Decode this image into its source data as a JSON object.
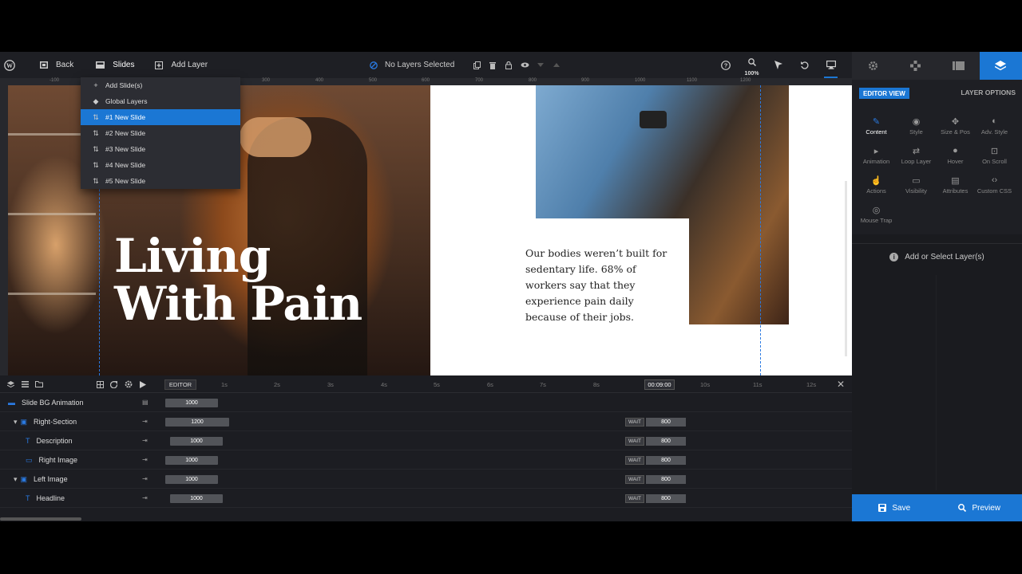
{
  "toolbar": {
    "back_label": "Back",
    "slides_label": "Slides",
    "add_layer_label": "Add Layer",
    "selection_status": "No Layers Selected",
    "zoom_level": "100%"
  },
  "ruler": {
    "ticks": [
      "-100",
      "100",
      "200",
      "300",
      "400",
      "500",
      "600",
      "700",
      "800",
      "900",
      "1000",
      "1100",
      "1200"
    ]
  },
  "slides_menu": {
    "items": [
      {
        "label": "Add Slide(s)",
        "icon": "plus-icon",
        "active": false
      },
      {
        "label": "Global Layers",
        "icon": "layers-icon",
        "active": false
      },
      {
        "label": "#1 New Slide",
        "icon": "slide-icon",
        "active": true
      },
      {
        "label": "#2 New Slide",
        "icon": "slide-icon",
        "active": false
      },
      {
        "label": "#3 New Slide",
        "icon": "slide-icon",
        "active": false
      },
      {
        "label": "#4 New Slide",
        "icon": "slide-icon",
        "active": false
      },
      {
        "label": "#5 New Slide",
        "icon": "slide-icon",
        "active": false
      }
    ]
  },
  "slide": {
    "headline_line1": "Living",
    "headline_line2": "With Pain",
    "description": "Our bodies weren’t built for sedentary life. 68% of workers say that they experience pain daily because of their jobs."
  },
  "timeline": {
    "editor_label": "EDITOR",
    "current_time": "00:09:00",
    "ticks": [
      "1s",
      "2s",
      "3s",
      "4s",
      "5s",
      "6s",
      "7s",
      "8s",
      "10s",
      "11s",
      "12s"
    ],
    "rows": [
      {
        "name": "Slide BG Animation",
        "bar": "1000",
        "wait": "",
        "end": ""
      },
      {
        "name": "Right-Section",
        "bar": "1200",
        "wait": "WAIT",
        "end": "800"
      },
      {
        "name": "Description",
        "bar": "1000",
        "wait": "WAIT",
        "end": "800"
      },
      {
        "name": "Right Image",
        "bar": "1000",
        "wait": "WAIT",
        "end": "800"
      },
      {
        "name": "Left Image",
        "bar": "1000",
        "wait": "WAIT",
        "end": "800"
      },
      {
        "name": "Headline",
        "bar": "1000",
        "wait": "WAIT",
        "end": "800"
      }
    ]
  },
  "right_panel": {
    "editor_view_label": "EDITOR VIEW",
    "layer_options_label": "LAYER OPTIONS",
    "options": [
      {
        "label": "Content",
        "icon": "pen-icon",
        "active": true
      },
      {
        "label": "Style",
        "icon": "palette-icon",
        "active": false
      },
      {
        "label": "Size & Pos",
        "icon": "move-icon",
        "active": false
      },
      {
        "label": "Adv. Style",
        "icon": "drop-icon",
        "active": false
      },
      {
        "label": "Animation",
        "icon": "play-icon",
        "active": false
      },
      {
        "label": "Loop Layer",
        "icon": "loop-icon",
        "active": false
      },
      {
        "label": "Hover",
        "icon": "mouse-icon",
        "active": false
      },
      {
        "label": "On Scroll",
        "icon": "scroll-icon",
        "active": false
      },
      {
        "label": "Actions",
        "icon": "hand-icon",
        "active": false
      },
      {
        "label": "Visibility",
        "icon": "visibility-icon",
        "active": false
      },
      {
        "label": "Attributes",
        "icon": "file-icon",
        "active": false
      },
      {
        "label": "Custom CSS",
        "icon": "code-icon",
        "active": false
      },
      {
        "label": "Mouse Trap",
        "icon": "target-icon",
        "active": false
      }
    ],
    "info_text": "Add or Select Layer(s)",
    "save_label": "Save",
    "preview_label": "Preview"
  },
  "colors": {
    "accent": "#1b77d4",
    "panel_bg": "#1e1f24",
    "dark_bg": "#1a1b1f"
  }
}
